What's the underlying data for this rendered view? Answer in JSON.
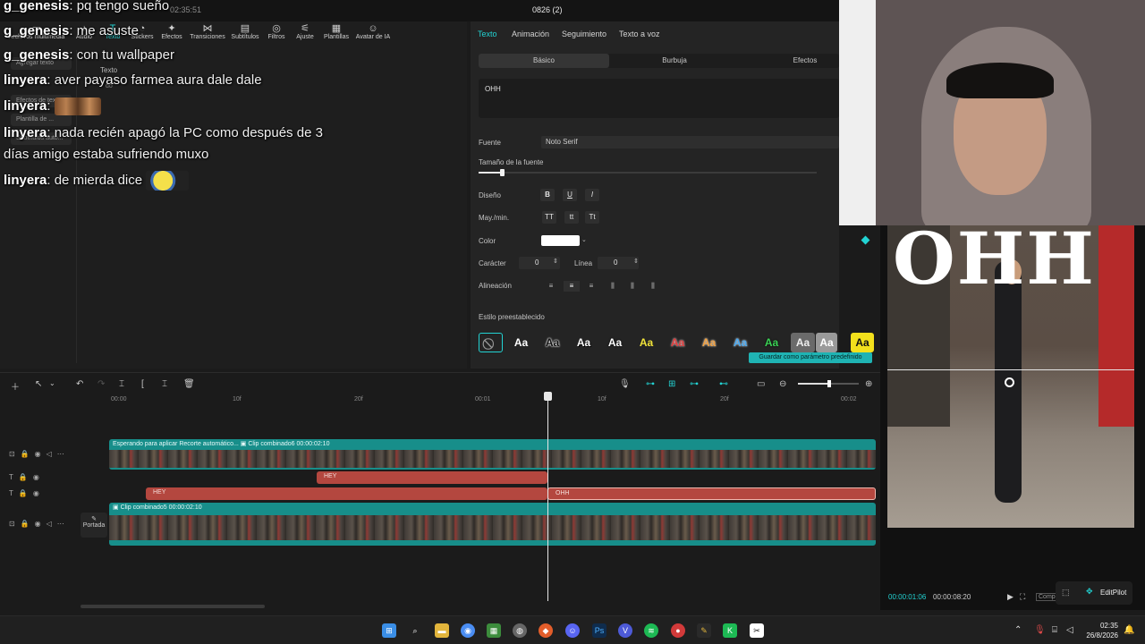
{
  "window": {
    "title": "0826 (2)",
    "record_time": "02:35:51"
  },
  "toolbar": {
    "items": [
      {
        "label": "Archivos multimedia",
        "icon": "media-icon"
      },
      {
        "label": "Audio",
        "icon": "audio-icon"
      },
      {
        "label": "Texto",
        "icon": "text-icon",
        "active": true
      },
      {
        "label": "Stickers",
        "icon": "sticker-icon"
      },
      {
        "label": "Efectos",
        "icon": "effects-icon"
      },
      {
        "label": "Transiciones",
        "icon": "transition-icon"
      },
      {
        "label": "Subtítulos",
        "icon": "subtitle-icon"
      },
      {
        "label": "Filtros",
        "icon": "filter-icon"
      },
      {
        "label": "Ajuste",
        "icon": "adjust-icon"
      },
      {
        "label": "Plantillas",
        "icon": "template-icon"
      },
      {
        "label": "Avatar de IA",
        "icon": "ai-avatar-icon"
      }
    ]
  },
  "leftnav": {
    "items": [
      "Agregar texto",
      "Efectos de texto",
      "Plantilla de ...",
      "Subtítulos auto..."
    ],
    "sub": {
      "text": "Texto",
      "extra": "do"
    }
  },
  "chat": [
    {
      "user": "g_genesis",
      "text": "pq tengo sueño"
    },
    {
      "user": "g_genesis",
      "text": "me asuste"
    },
    {
      "user": "g_genesis",
      "text": "con tu wallpaper"
    },
    {
      "user": "linyera",
      "text": "aver payaso farmea aura dale dale"
    },
    {
      "user": "linyera",
      "text": ""
    },
    {
      "user": "linyera",
      "text": "nada recién apagó la PC como después de 3"
    },
    {
      "user": "",
      "text": "días amigo estaba sufriendo muxo"
    },
    {
      "user": "linyera",
      "text": "de mierda dice"
    }
  ],
  "props": {
    "tabs": [
      "Texto",
      "Animación",
      "Seguimiento",
      "Texto a voz"
    ],
    "subtabs": [
      "Básico",
      "Burbuja",
      "Efectos"
    ],
    "text_value": "OHH",
    "font_label": "Fuente",
    "font_value": "Noto Serif",
    "size_label": "Tamaño de la fuente",
    "size_fraction": 0.07,
    "style_label": "Diseño",
    "case_label": "May./min.",
    "case_options": [
      "TT",
      "tt",
      "Tt"
    ],
    "color_label": "Color",
    "color_value": "#ffffff",
    "char_label": "Carácter",
    "char_value": "0",
    "line_label": "Línea",
    "line_value": "0",
    "align_label": "Alineación",
    "preset_label": "Estilo preestablecido",
    "preset_text": "Aa",
    "save_label": "Guardar como parámetro predefinido"
  },
  "preview": {
    "caption": "OHH",
    "current_time": "00:00:01:06",
    "total_time": "00:00:08:20",
    "editpilot_label": "EditPilot",
    "comp_label": "Comp"
  },
  "timeline": {
    "ruler": [
      "00:00",
      "10f",
      "20f",
      "00:01",
      "10f",
      "20f",
      "00:02"
    ],
    "clips": {
      "video1_status": "Esperando para aplicar Recorte automático...",
      "video1_name": "Clip combinado6",
      "video1_duration": "00:00:02:10",
      "text1": "HEY",
      "text2": "HEY",
      "text3": "OHH",
      "video2_name": "Clip combinado5",
      "video2_duration": "00:00:02:10",
      "cover_label": "Portada"
    }
  },
  "taskbar": {
    "clock_time": "02:35",
    "clock_date": "26/8/2026"
  },
  "colors": {
    "accent": "#22d3d3",
    "text_clip": "#b4473f",
    "video_clip": "#178e8a"
  }
}
